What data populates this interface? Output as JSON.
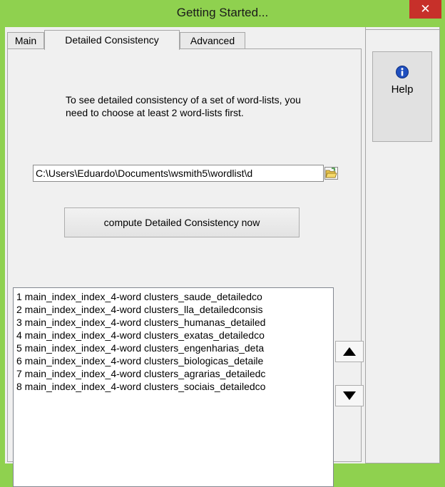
{
  "window": {
    "title": "Getting Started...",
    "close_label": "✕"
  },
  "tabs": [
    {
      "label": "Main"
    },
    {
      "label": "Detailed Consistency"
    },
    {
      "label": "Advanced"
    }
  ],
  "panel": {
    "instructions": "To see detailed consistency of a set of word-lists, you need to choose at least 2 word-lists first.",
    "path_value": "C:\\Users\\Eduardo\\Documents\\wsmith5\\wordlist\\d",
    "compute_label": "compute Detailed Consistency now",
    "list_items": [
      "1 main_index_index_4-word clusters_saude_detailedco",
      "2 main_index_index_4-word clusters_lla_detailedconsis",
      "3 main_index_index_4-word clusters_humanas_detailed",
      "4 main_index_index_4-word clusters_exatas_detailedco",
      "5 main_index_index_4-word clusters_engenharias_deta",
      "6 main_index_index_4-word clusters_biologicas_detaile",
      "7 main_index_index_4-word clusters_agrarias_detailedc",
      "8 main_index_index_4-word clusters_sociais_detailedco"
    ]
  },
  "sidebar": {
    "help_label": "Help"
  },
  "icons": {
    "close": "close-icon",
    "folder": "folder-open-icon",
    "help": "info-icon",
    "up": "triangle-up-icon",
    "down": "triangle-down-icon"
  },
  "colors": {
    "titlebar": "#8fd14f",
    "close": "#c7302a",
    "panel": "#f0f0f0",
    "help_icon": "#1f4fbf"
  }
}
